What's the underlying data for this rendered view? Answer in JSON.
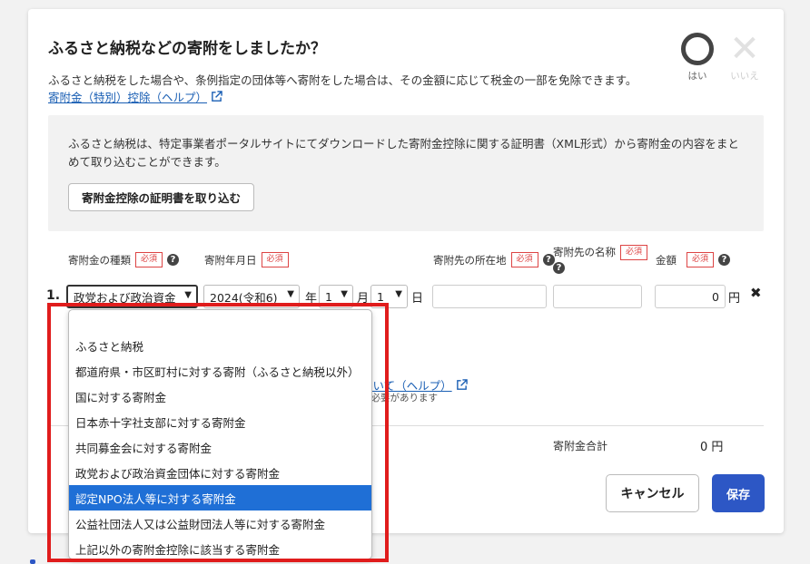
{
  "modal": {
    "title": "ふるさと納税などの寄附をしましたか？",
    "description": "ふるさと納税をした場合や、条例指定の団体等へ寄附をした場合は、その金額に応じて税金の一部を免除できます。",
    "help_link": "寄附金（特別）控除（ヘルプ）",
    "yes_label": "はい",
    "no_label": "いいえ"
  },
  "info": {
    "text": "ふるさと納税は、特定事業者ポータルサイトにてダウンロードした寄附金控除に関する証明書（XML形式）から寄附金の内容をまとめて取り込むことができます。",
    "import_button": "寄附金控除の証明書を取り込む"
  },
  "columns": {
    "type": "寄附金の種類",
    "date": "寄附年月日",
    "address": "寄附先の所在地",
    "name": "寄附先の名称",
    "amount": "金額",
    "required": "必須"
  },
  "row": {
    "number": "1.",
    "type_value": "政党および政治資金",
    "year_value": "2024(令和6)",
    "year_unit": "年",
    "month_value": "1",
    "month_unit": "月",
    "day_value": "1",
    "day_unit": "日",
    "amount_value": "0",
    "amount_unit": "円"
  },
  "behind": {
    "link": "ついて（ヘルプ）",
    "note": "る必要があります"
  },
  "total": {
    "label": "寄附金合計",
    "value": "0 円"
  },
  "buttons": {
    "cancel": "キャンセル",
    "save": "保存"
  },
  "dropdown": {
    "options": [
      "",
      "ふるさと納税",
      "都道府県・市区町村に対する寄附（ふるさと納税以外）",
      "国に対する寄附金",
      "日本赤十字社支部に対する寄附金",
      "共同募金会に対する寄附金",
      "政党および政治資金団体に対する寄附金",
      "認定NPO法人等に対する寄附金",
      "公益社団法人又は公益財団法人等に対する寄附金",
      "上記以外の寄附金控除に該当する寄附金"
    ],
    "highlighted_index": 7
  },
  "colors": {
    "accent": "#2d57c5",
    "highlight": "#1f6fd6",
    "annotation": "#e01c1c"
  }
}
